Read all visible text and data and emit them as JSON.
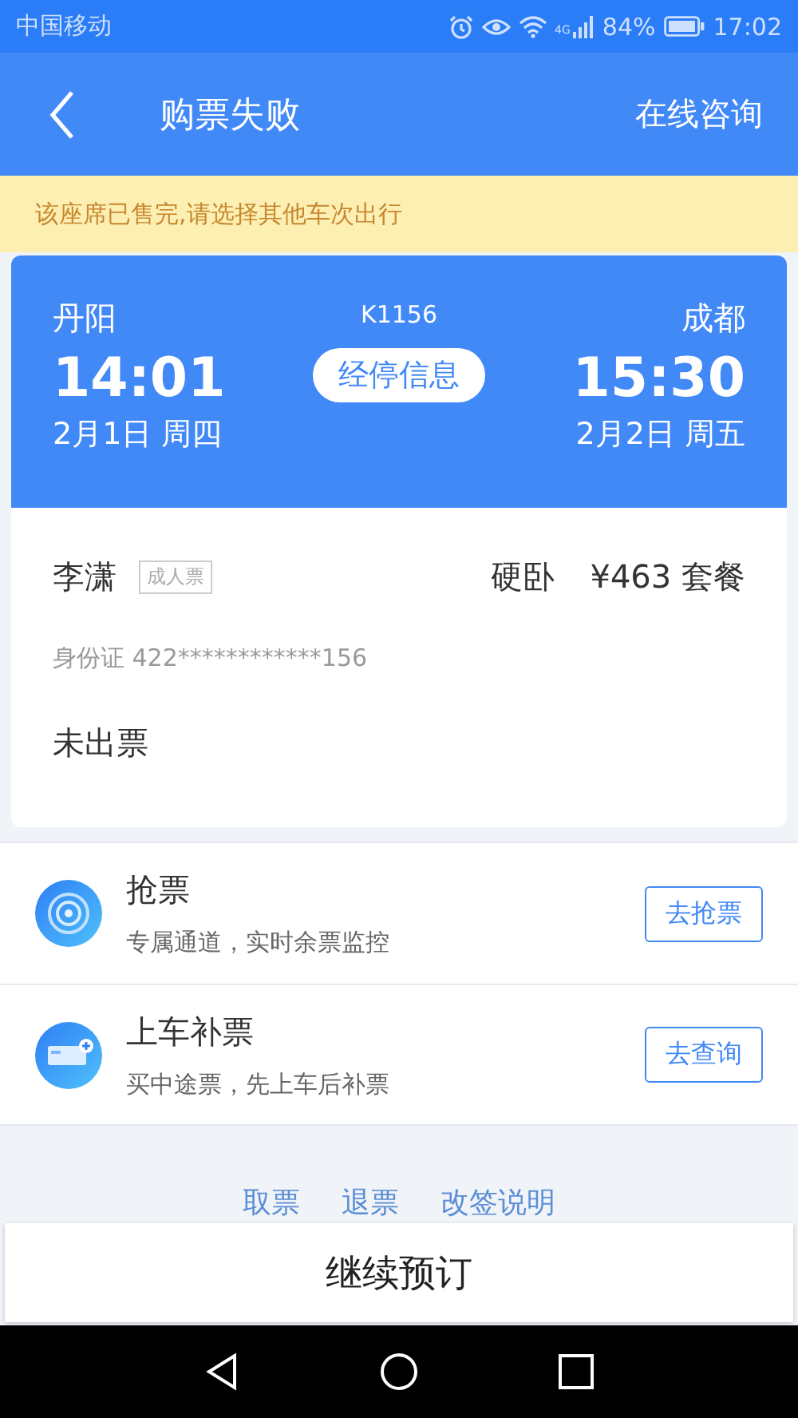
{
  "status_bar": {
    "carrier": "中国移动",
    "network": "4G",
    "battery": "84%",
    "time": "17:02"
  },
  "nav": {
    "title": "购票失败",
    "action": "在线咨询"
  },
  "notice": "该座席已售完,请选择其他车次出行",
  "trip": {
    "from": "丹阳",
    "to": "成都",
    "train": "K1156",
    "depart_time": "14:01",
    "arrive_time": "15:30",
    "depart_date": "2月1日 周四",
    "arrive_date": "2月2日 周五",
    "stops_button": "经停信息"
  },
  "passenger": {
    "name": "李潇",
    "ticket_type": "成人票",
    "seat": "硬卧",
    "price": "¥463 套餐",
    "id": "身份证 422************156",
    "status": "未出票"
  },
  "options": [
    {
      "kind": "radar",
      "title": "抢票",
      "subtitle": "专属通道，实时余票监控",
      "button": "去抢票"
    },
    {
      "kind": "ticket",
      "title": "上车补票",
      "subtitle": "买中途票，先上车后补票",
      "button": "去查询"
    }
  ],
  "links": [
    "取票",
    "退票",
    "改签说明"
  ],
  "primary_button": "继续预订"
}
